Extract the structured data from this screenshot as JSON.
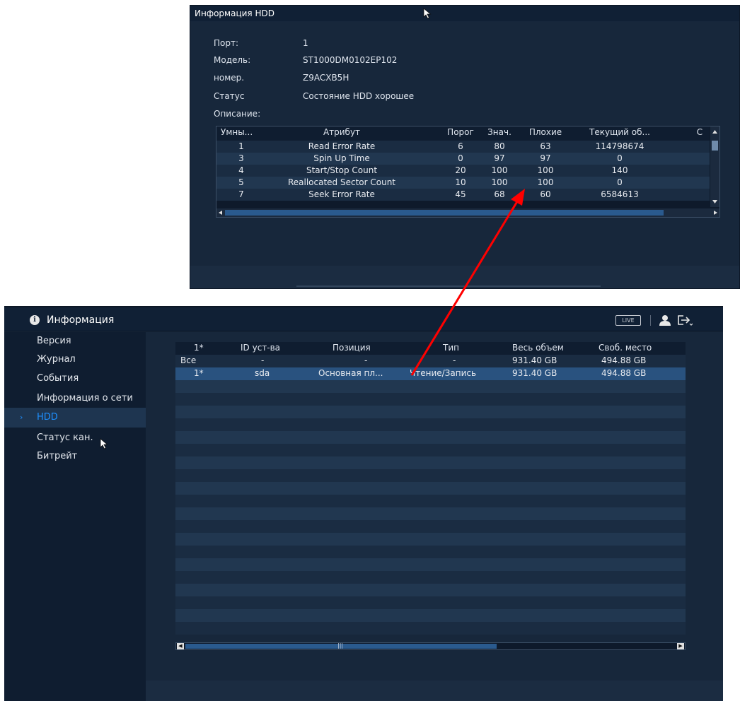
{
  "main": {
    "header": {
      "title": "Информация",
      "live_label": "LIVE",
      "icons": [
        "info-icon",
        "user-icon",
        "logout-icon"
      ]
    },
    "sidebar": {
      "items": [
        {
          "label": "Версия",
          "active": false
        },
        {
          "label": "Журнал",
          "active": false
        },
        {
          "label": "События",
          "active": false
        },
        {
          "label": "Информация о сети",
          "active": false
        },
        {
          "label": "HDD",
          "active": true
        },
        {
          "label": "Статус кан.",
          "active": false
        },
        {
          "label": "Битрейт",
          "active": false
        }
      ]
    },
    "hdd_table": {
      "columns": [
        "1*",
        "ID уст-ва",
        "Позиция",
        "Тип",
        "Весь объем",
        "Своб. место"
      ],
      "rows": [
        [
          "Все",
          "-",
          "-",
          "-",
          "931.40 GB",
          "494.88 GB"
        ],
        [
          "1*",
          "sda",
          "Основная пл...",
          "Чтение/Запись",
          "931.40 GB",
          "494.88 GB"
        ]
      ],
      "selected_row": 1
    }
  },
  "popup": {
    "title": "Информация HDD",
    "fields": [
      {
        "label": "Порт:",
        "value": "1"
      },
      {
        "label": "Модель:",
        "value": "ST1000DM0102EP102"
      },
      {
        "label": "номер.",
        "value": "Z9ACXB5H"
      },
      {
        "label": "Статус",
        "value": "Состояние HDD хорошее"
      },
      {
        "label": "Описание:",
        "value": ""
      }
    ],
    "smart_table": {
      "columns": [
        "Умны...",
        "Атрибут",
        "Порог",
        "Знач.",
        "Плохие",
        "Текущий об...",
        "С"
      ],
      "rows": [
        [
          "1",
          "Read Error Rate",
          "6",
          "80",
          "63",
          "114798674"
        ],
        [
          "3",
          "Spin Up Time",
          "0",
          "97",
          "97",
          "0"
        ],
        [
          "4",
          "Start/Stop Count",
          "20",
          "100",
          "100",
          "140"
        ],
        [
          "5",
          "Reallocated Sector Count",
          "10",
          "100",
          "100",
          "0"
        ],
        [
          "7",
          "Seek Error Rate",
          "45",
          "68",
          "60",
          "6584613"
        ]
      ]
    }
  },
  "colors": {
    "background": "#17273b",
    "active_item": "#1e90ff",
    "selection": "#29527f",
    "arrow": "#ff0000"
  }
}
